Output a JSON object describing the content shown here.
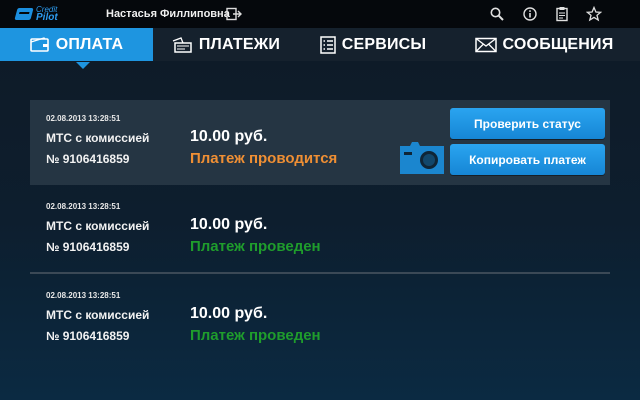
{
  "app": {
    "logo_line1": "Credit",
    "logo_line2": "Pilot",
    "user_name": "Настасья Филлиповна"
  },
  "colors": {
    "accent": "#1e95e0",
    "pending": "#ef8f34",
    "done": "#1f9d2c"
  },
  "top_icons": [
    "search-icon",
    "info-icon",
    "clipboard-icon",
    "star-icon"
  ],
  "nav": {
    "tabs": [
      {
        "label": "ОПЛАТА",
        "icon": "wallet-icon",
        "active": true
      },
      {
        "label": "ПЛАТЕЖИ",
        "icon": "payments-icon",
        "active": false
      },
      {
        "label": "СЕРВИСЫ",
        "icon": "list-icon",
        "active": false
      },
      {
        "label": "СООБЩЕНИЯ",
        "icon": "envelope-icon",
        "active": false
      }
    ]
  },
  "payments": [
    {
      "date": "02.08.2013 13:28:51",
      "service": "МТС с комиссией",
      "number": "№ 9106416859",
      "amount": "10.00 руб.",
      "status": "Платеж проводится",
      "state": "pending"
    },
    {
      "date": "02.08.2013 13:28:51",
      "service": "МТС с комиссией",
      "number": "№ 9106416859",
      "amount": "10.00 руб.",
      "status": "Платеж проведен",
      "state": "done"
    },
    {
      "date": "02.08.2013 13:28:51",
      "service": "МТС с комиссией",
      "number": "№ 9106416859",
      "amount": "10.00 руб.",
      "status": "Платеж проведен",
      "state": "done"
    }
  ],
  "actions": {
    "check_status": "Проверить статус",
    "copy_payment": "Копировать платеж"
  }
}
